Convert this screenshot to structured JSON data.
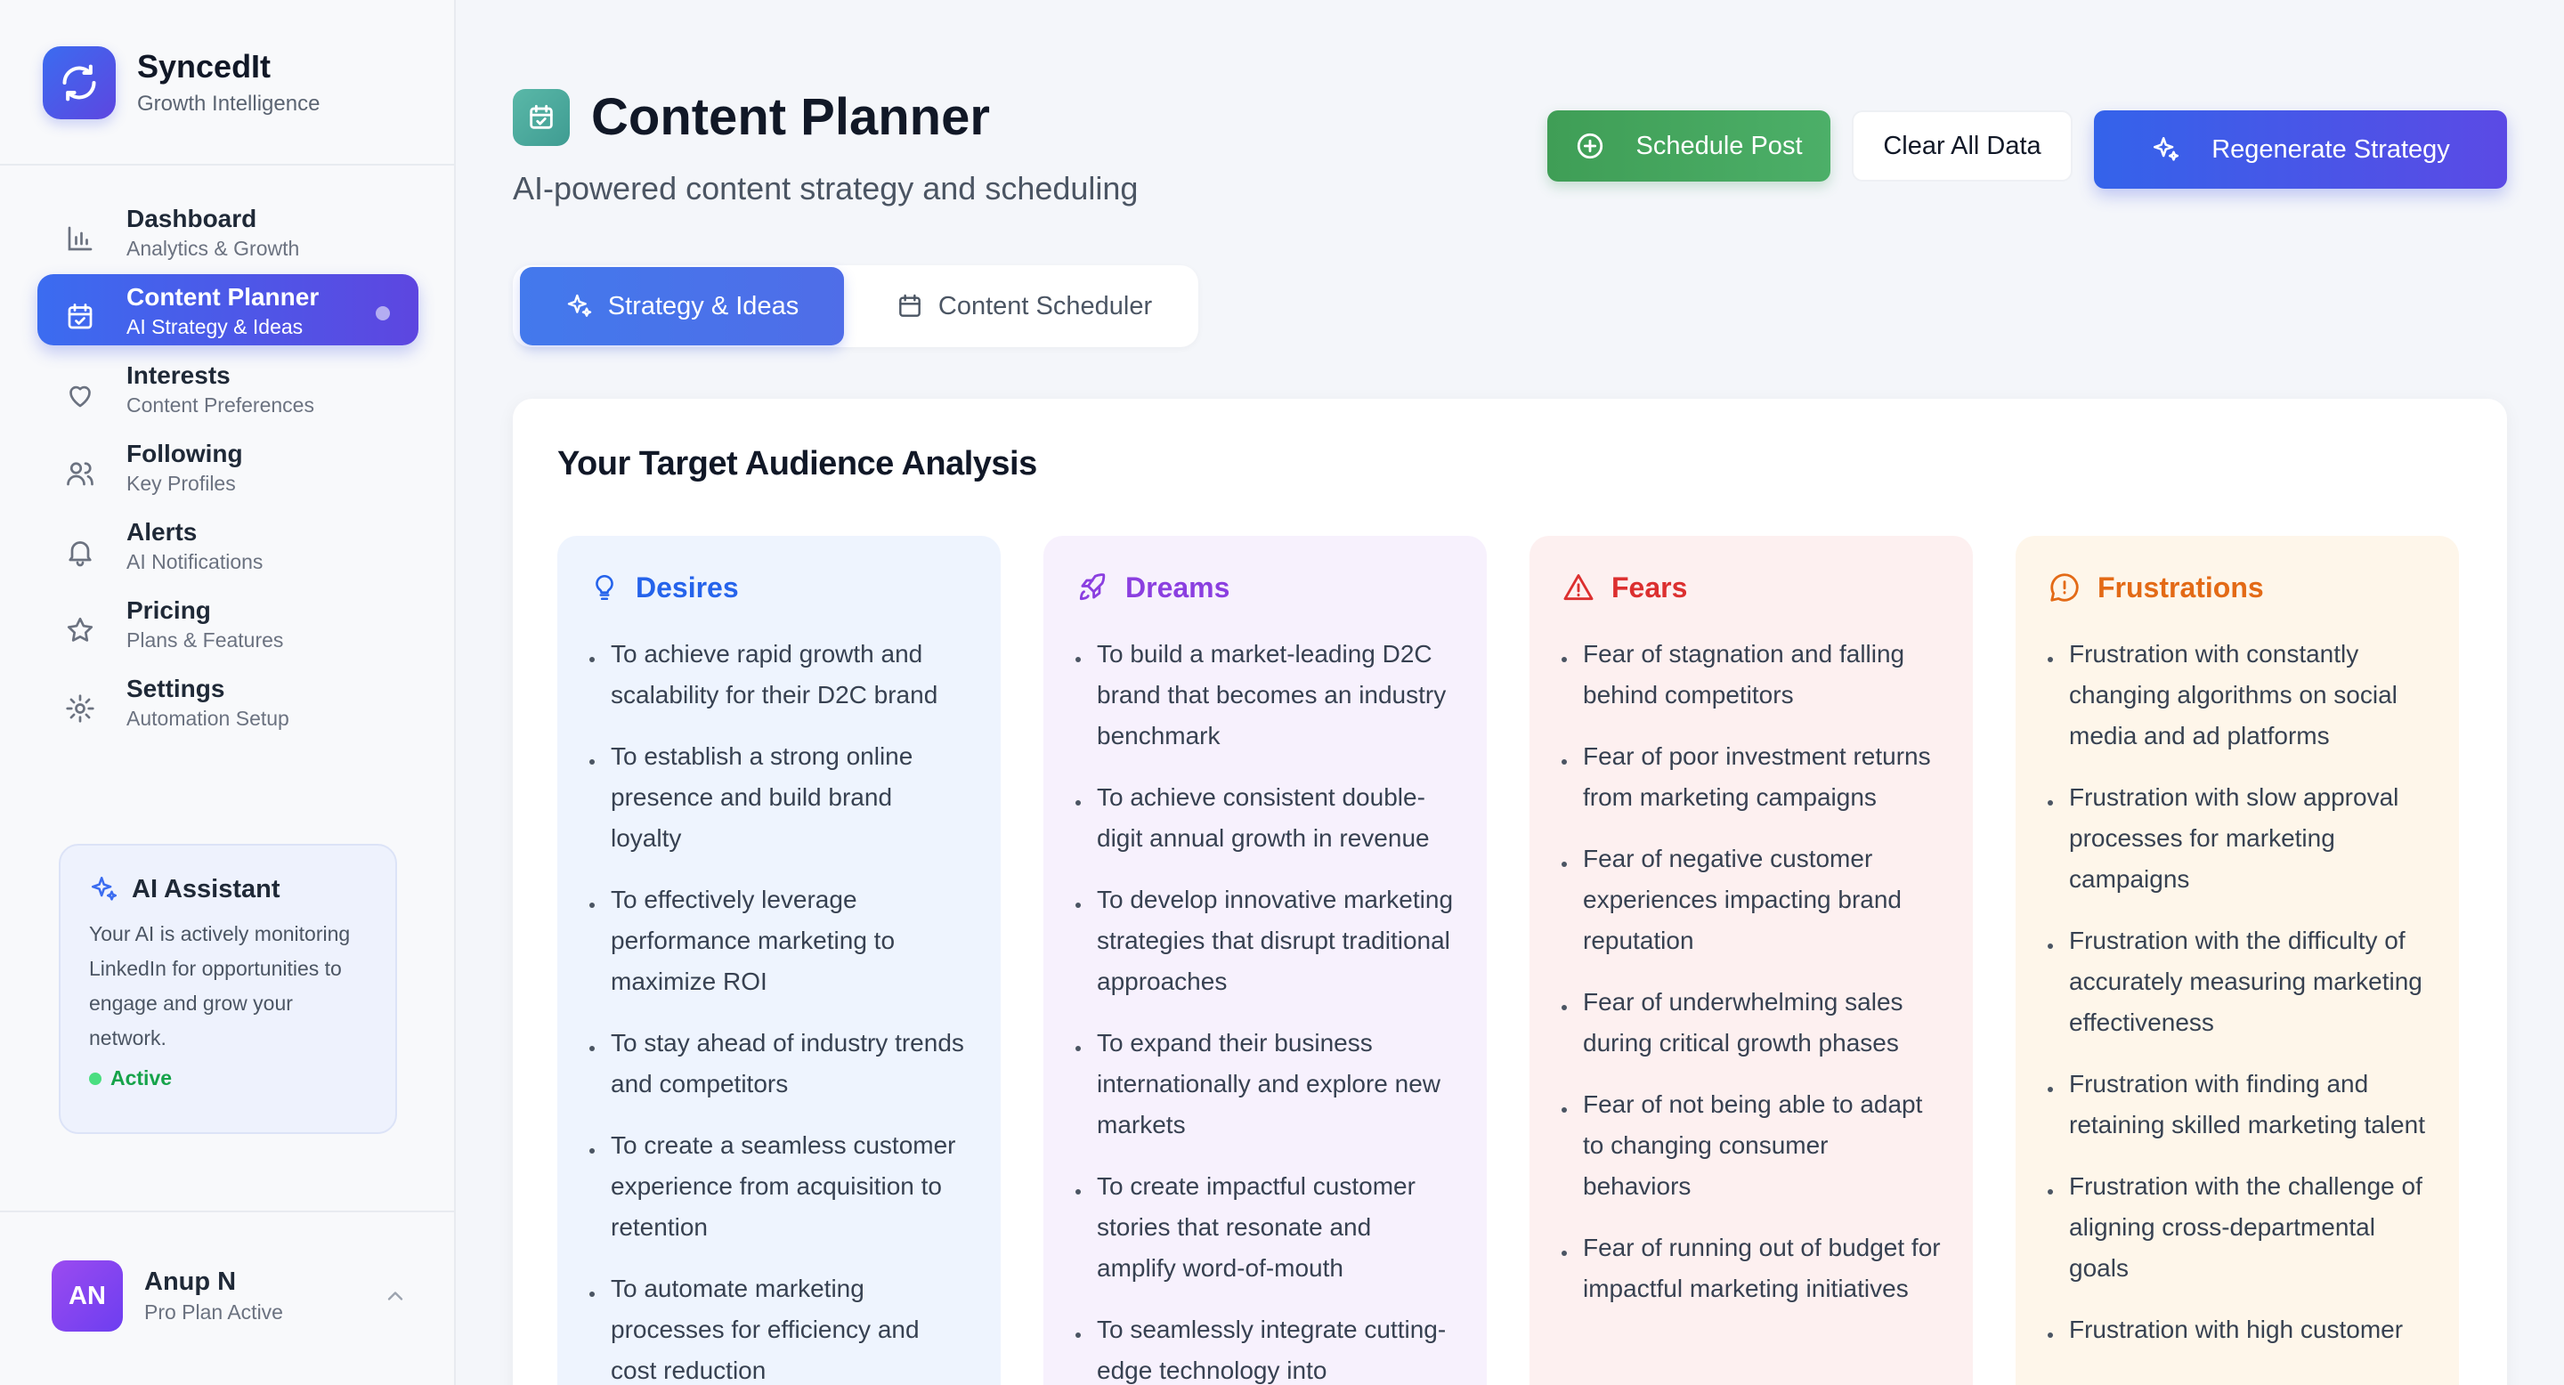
{
  "brand": {
    "name": "SyncedIt",
    "tagline": "Growth Intelligence"
  },
  "sidebar": {
    "items": [
      {
        "title": "Dashboard",
        "subtitle": "Analytics & Growth",
        "icon": "bar-chart-icon"
      },
      {
        "title": "Content Planner",
        "subtitle": "AI Strategy & Ideas",
        "icon": "calendar-check-icon",
        "active": true
      },
      {
        "title": "Interests",
        "subtitle": "Content Preferences",
        "icon": "heart-icon"
      },
      {
        "title": "Following",
        "subtitle": "Key Profiles",
        "icon": "users-icon"
      },
      {
        "title": "Alerts",
        "subtitle": "AI Notifications",
        "icon": "bell-icon"
      },
      {
        "title": "Pricing",
        "subtitle": "Plans & Features",
        "icon": "star-icon"
      },
      {
        "title": "Settings",
        "subtitle": "Automation Setup",
        "icon": "gear-icon"
      }
    ]
  },
  "ai_assistant": {
    "title": "AI Assistant",
    "body": "Your AI is actively monitoring LinkedIn for opportunities to engage and grow your network.",
    "status": "Active"
  },
  "user": {
    "initials": "AN",
    "name": "Anup N",
    "plan": "Pro Plan Active"
  },
  "header": {
    "title": "Content Planner",
    "subtitle": "AI-powered content strategy and scheduling",
    "schedule_label": "Schedule Post",
    "clear_label": "Clear All Data",
    "regenerate_label": "Regenerate Strategy"
  },
  "tabs": [
    {
      "label": "Strategy & Ideas",
      "active": true
    },
    {
      "label": "Content Scheduler",
      "active": false
    }
  ],
  "audience": {
    "title": "Your Target Audience Analysis",
    "columns": [
      {
        "title": "Desires",
        "icon": "lightbulb-icon",
        "items": [
          "To achieve rapid growth and scalability for their D2C brand",
          "To establish a strong online presence and build brand loyalty",
          "To effectively leverage performance marketing to maximize ROI",
          "To stay ahead of industry trends and competitors",
          "To create a seamless customer experience from acquisition to retention",
          "To automate marketing processes for efficiency and cost reduction"
        ]
      },
      {
        "title": "Dreams",
        "icon": "rocket-icon",
        "items": [
          "To build a market-leading D2C brand that becomes an industry benchmark",
          "To achieve consistent double-digit annual growth in revenue",
          "To develop innovative marketing strategies that disrupt traditional approaches",
          "To expand their business internationally and explore new markets",
          "To create impactful customer stories that resonate and amplify word-of-mouth",
          "To seamlessly integrate cutting-edge technology into"
        ]
      },
      {
        "title": "Fears",
        "icon": "warning-triangle-icon",
        "items": [
          "Fear of stagnation and falling behind competitors",
          "Fear of poor investment returns from marketing campaigns",
          "Fear of negative customer experiences impacting brand reputation",
          "Fear of underwhelming sales during critical growth phases",
          "Fear of not being able to adapt to changing consumer behaviors",
          "Fear of running out of budget for impactful marketing initiatives"
        ]
      },
      {
        "title": "Frustrations",
        "icon": "alert-bubble-icon",
        "items": [
          "Frustration with constantly changing algorithms on social media and ad platforms",
          "Frustration with slow approval processes for marketing campaigns",
          "Frustration with the difficulty of accurately measuring marketing effectiveness",
          "Frustration with finding and retaining skilled marketing talent",
          "Frustration with the challenge of aligning cross-departmental goals",
          "Frustration with high customer"
        ]
      }
    ]
  },
  "colors": {
    "primary": "#3b6cf0",
    "accent_purple": "#5d46e0",
    "success": "#4caf68",
    "desires": "#2563eb",
    "dreams": "#8b3fe0",
    "fears": "#dc2f2f",
    "frustrations": "#e36a16"
  }
}
